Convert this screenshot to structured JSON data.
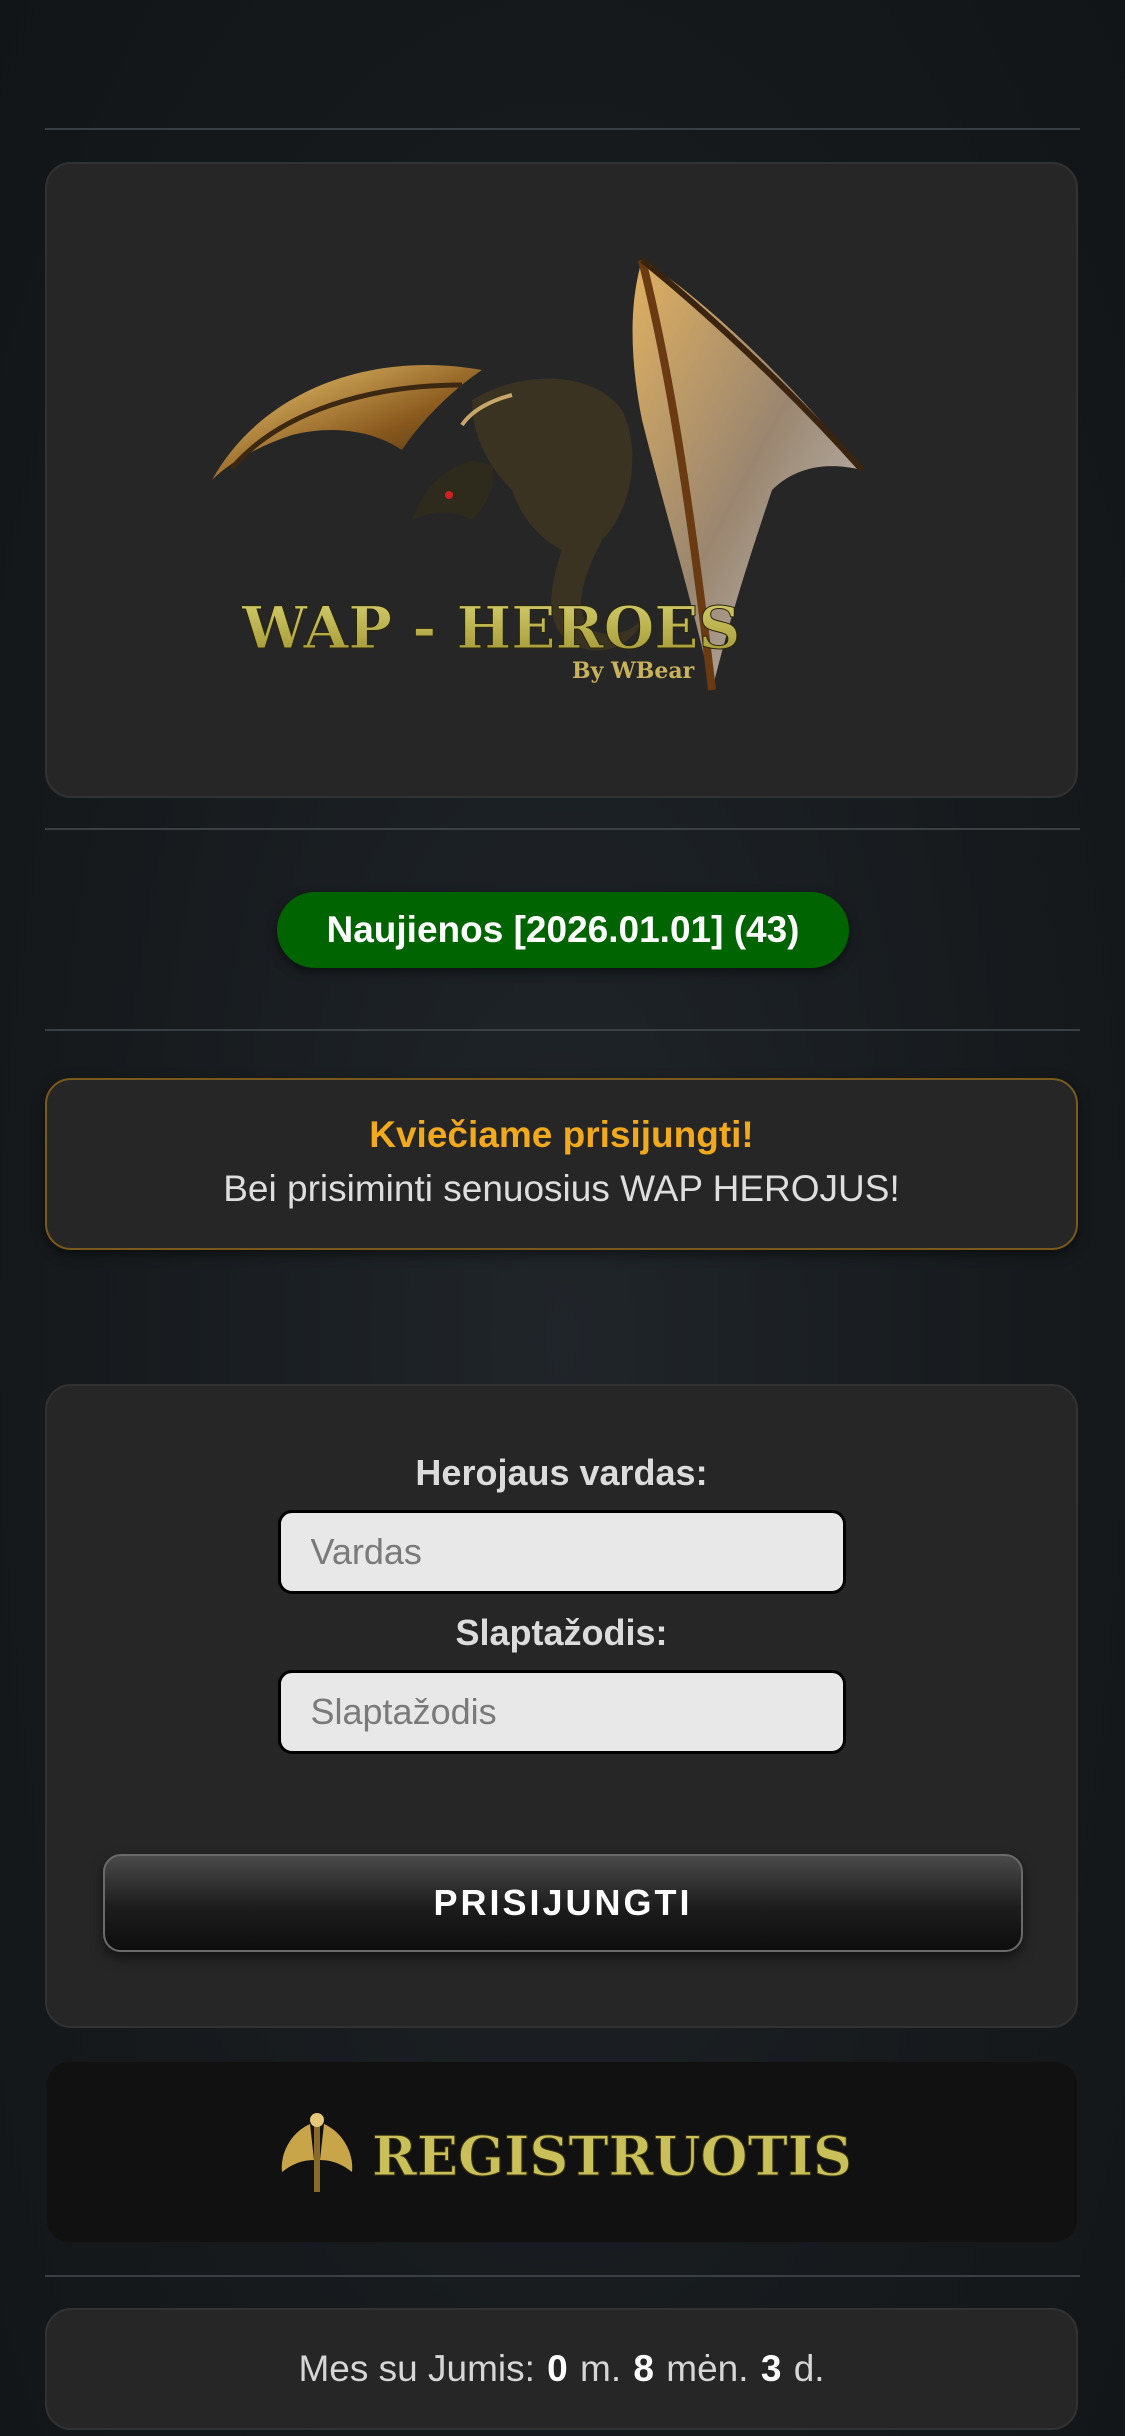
{
  "banner": {
    "title": "WAP - HEROES",
    "byline": "By WBear",
    "icon": "dragon-icon"
  },
  "news": {
    "label": "Naujienos [2026.01.01] (43)"
  },
  "welcome": {
    "title": "Kviečiame prisijungti!",
    "subtitle": "Bei prisiminti senuosius WAP HEROJUS!"
  },
  "login": {
    "username_label": "Herojaus vardas:",
    "username_placeholder": "Vardas",
    "password_label": "Slaptažodis:",
    "password_placeholder": "Slaptažodis",
    "submit_label": "PRISIJUNGTI"
  },
  "register": {
    "label": "REGISTRUOTIS",
    "icon": "axe-icon"
  },
  "uptime": {
    "prefix": "Mes su Jumis:",
    "years": "0",
    "years_unit": "m.",
    "months": "8",
    "months_unit": "mėn.",
    "days": "3",
    "days_unit": "d."
  },
  "colors": {
    "news_bg": "#006400",
    "welcome_title": "#f2a91c",
    "logo_text": "#c9c05a"
  }
}
